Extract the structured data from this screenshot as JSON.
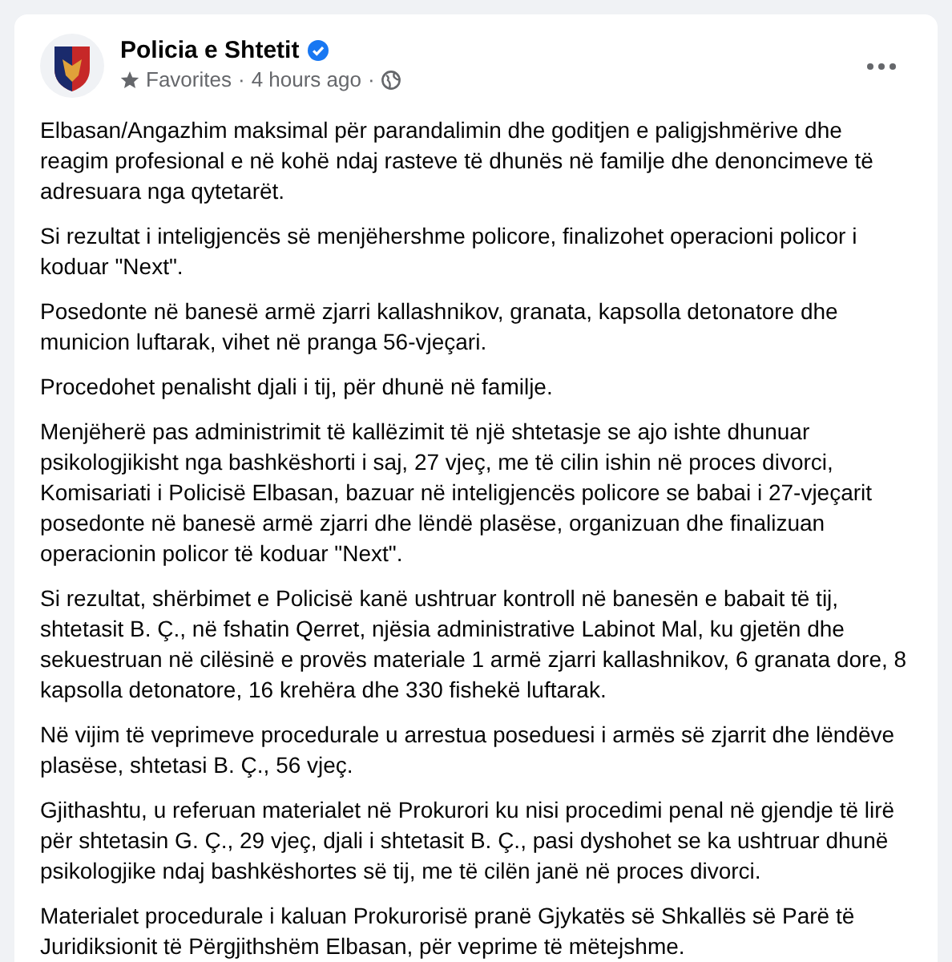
{
  "post": {
    "author": "Policia e Shtetit",
    "verified": true,
    "audience_label": "Favorites",
    "time": "4 hours ago",
    "separators": [
      "·",
      "·"
    ],
    "paragraphs": [
      "Elbasan/Angazhim maksimal për parandalimin dhe goditjen e paligjshmërive dhe reagim profesional e në kohë ndaj rasteve të dhunës në familje dhe denoncimeve të adresuara nga qytetarët.",
      "Si rezultat i inteligjencës së menjëhershme policore, finalizohet operacioni policor i koduar \"Next\".",
      "Posedonte në banesë armë zjarri kallashnikov, granata, kapsolla detonatore dhe municion luftarak, vihet në pranga 56-vjeçari.",
      "Procedohet penalisht djali i tij, për dhunë në familje.",
      "Menjëherë pas administrimit të kallëzimit të një shtetasje se ajo ishte dhunuar psikologjikisht nga bashkëshorti i saj, 27 vjeç, me të cilin ishin në proces divorci, Komisariati i Policisë Elbasan, bazuar në inteligjencës policore se babai i 27-vjeçarit posedonte në banesë  armë zjarri dhe lëndë plasëse, organizuan dhe finalizuan operacionin policor të koduar \"Next\".",
      "Si rezultat, shërbimet e Policisë kanë ushtruar kontroll në banesën e babait të tij, shtetasit B. Ç., në fshatin Qerret, njësia administrative Labinot Mal, ku gjetën dhe sekuestruan në cilësinë e provës materiale 1 armë zjarri kallashnikov, 6 granata dore, 8 kapsolla detonatore, 16 krehëra dhe 330 fishekë luftarak.",
      "Në vijim të veprimeve procedurale u arrestua poseduesi i armës së zjarrit dhe lëndëve plasëse, shtetasi B. Ç., 56 vjeç.",
      "Gjithashtu, u referuan materialet në Prokurori ku nisi procedimi penal në gjendje të lirë për shtetasin G. Ç., 29 vjeç, djali i shtetasit B. Ç., pasi dyshohet se ka ushtruar dhunë psikologjike ndaj bashkëshortes së tij, me të cilën janë në proces divorci.",
      "Materialet procedurale i kaluan Prokurorisë pranë Gjykatës së Shkallës së Parë të Juridiksionit të Përgjithshëm Elbasan, për veprime të mëtejshme."
    ]
  }
}
